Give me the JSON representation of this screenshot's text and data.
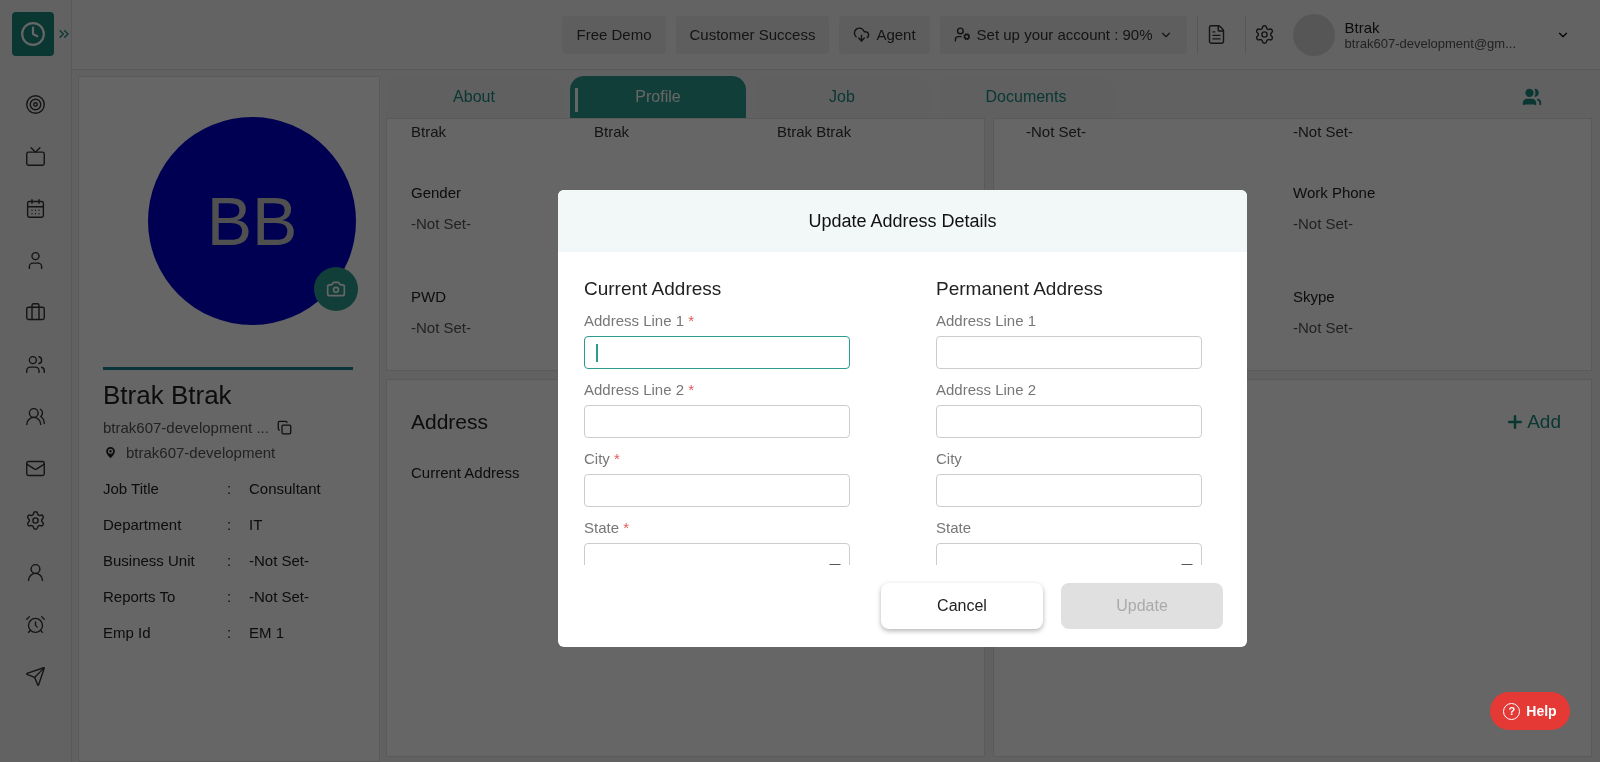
{
  "topbar": {
    "buttons": [
      {
        "label": "Free Demo",
        "kind": "plain"
      },
      {
        "label": "Customer Success",
        "kind": "plain"
      },
      {
        "label": "Agent",
        "kind": "cloud"
      },
      {
        "label": "Set up your account : 90%",
        "kind": "setup"
      }
    ],
    "user": {
      "name": "Btrak",
      "email": "btrak607-development@gm..."
    }
  },
  "profile": {
    "initials": "BB",
    "name": "Btrak Btrak",
    "email": "btrak607-development ...",
    "location": "btrak607-development",
    "details": [
      {
        "label": "Job Title",
        "sep": ":",
        "value": "Consultant"
      },
      {
        "label": "Department",
        "sep": ":",
        "value": "IT"
      },
      {
        "label": "Business Unit",
        "sep": ":",
        "value": "-Not Set-"
      },
      {
        "label": "Reports To",
        "sep": ":",
        "value": "-Not Set-"
      },
      {
        "label": "Emp Id",
        "sep": ":",
        "value": "EM 1"
      }
    ]
  },
  "tabs": [
    {
      "label": "About",
      "selected": false
    },
    {
      "label": "Profile",
      "selected": true
    },
    {
      "label": "Job",
      "selected": false
    },
    {
      "label": "Documents",
      "selected": false
    }
  ],
  "personal_panel": {
    "cut_row": [
      "Btrak",
      "Btrak",
      "Btrak Btrak"
    ],
    "fields": [
      {
        "label": "Gender",
        "value": "-Not Set-"
      },
      {
        "label": "PWD",
        "value": "-Not Set-"
      }
    ]
  },
  "contact_panel": {
    "cut_row": [
      "-Not Set-",
      "-Not Set-"
    ],
    "fields": [
      {
        "label": "Work Phone",
        "value": "-Not Set-"
      },
      {
        "label": "Skype",
        "value": "-Not Set-"
      }
    ]
  },
  "address_panel": {
    "title": "Address",
    "label": "Current Address",
    "add": "Add"
  },
  "dialog": {
    "title": "Update Address Details",
    "required_mark": "*",
    "columns": [
      {
        "heading": "Current Address",
        "fields": [
          {
            "label": "Address Line 1",
            "required": true,
            "kind": "text",
            "focused": true
          },
          {
            "label": "Address Line 2",
            "required": true,
            "kind": "text",
            "focused": false
          },
          {
            "label": "City",
            "required": true,
            "kind": "text",
            "focused": false
          },
          {
            "label": "State",
            "required": true,
            "kind": "select",
            "focused": false
          }
        ]
      },
      {
        "heading": "Permanent Address",
        "fields": [
          {
            "label": "Address Line 1",
            "required": false,
            "kind": "text",
            "focused": false
          },
          {
            "label": "Address Line 2",
            "required": false,
            "kind": "text",
            "focused": false
          },
          {
            "label": "City",
            "required": false,
            "kind": "text",
            "focused": false
          },
          {
            "label": "State",
            "required": false,
            "kind": "select",
            "focused": false
          }
        ]
      }
    ],
    "buttons": [
      {
        "label": "Cancel",
        "disabled": false
      },
      {
        "label": "Update",
        "disabled": true
      }
    ]
  },
  "help": {
    "label": "Help",
    "glyph": "?"
  }
}
